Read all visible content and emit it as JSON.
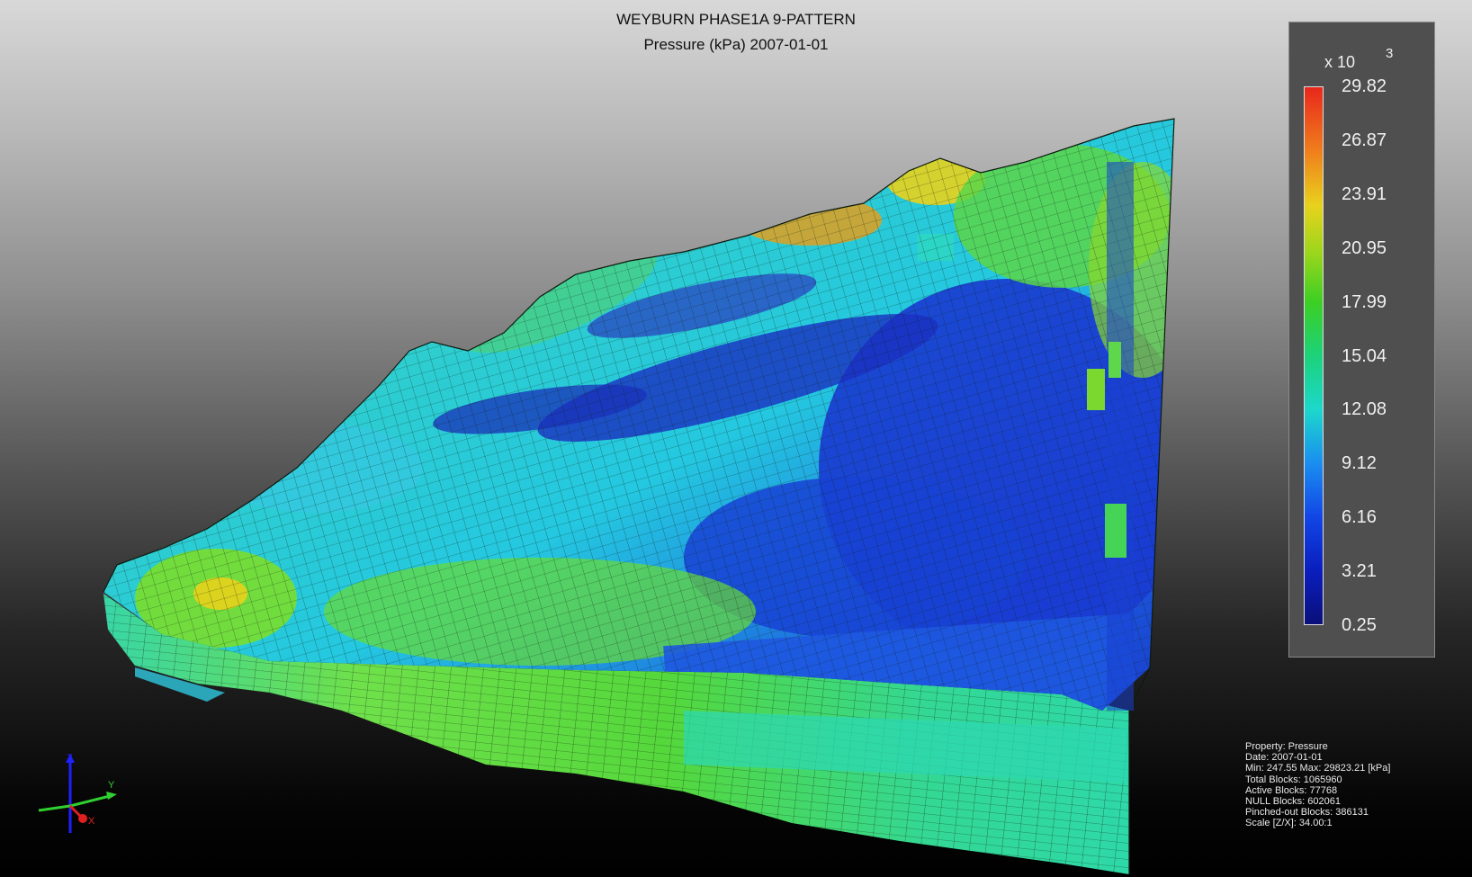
{
  "title": {
    "line1": "WEYBURN PHASE1A 9-PATTERN",
    "line2": "Pressure (kPa)  2007-01-01"
  },
  "legend": {
    "multiplier": "x 10",
    "exponent": "3",
    "ticks": [
      "29.82",
      "26.87",
      "23.91",
      "20.95",
      "17.99",
      "15.04",
      "12.08",
      "9.12",
      "6.16",
      "3.21",
      "0.25"
    ],
    "colors": [
      "#e8271c",
      "#f07f1c",
      "#e8d21c",
      "#9ad61c",
      "#3ccf24",
      "#1cd27a",
      "#1cd8cc",
      "#1a8ef0",
      "#1246e6",
      "#0a1ebe",
      "#0a0f7a"
    ]
  },
  "axis": {
    "z": "Z",
    "y": "Y",
    "x": "X"
  },
  "stats": {
    "property": "Property: Pressure",
    "date": "Date: 2007-01-01",
    "minmax": "Min: 247.55  Max: 29823.21 [kPa]",
    "total": "Total Blocks: 1065960",
    "active": "Active Blocks: 77768",
    "null": "NULL Blocks: 602061",
    "pinched": "Pinched-out Blocks: 386131",
    "scale": "Scale [Z/X]: 34.00:1"
  }
}
